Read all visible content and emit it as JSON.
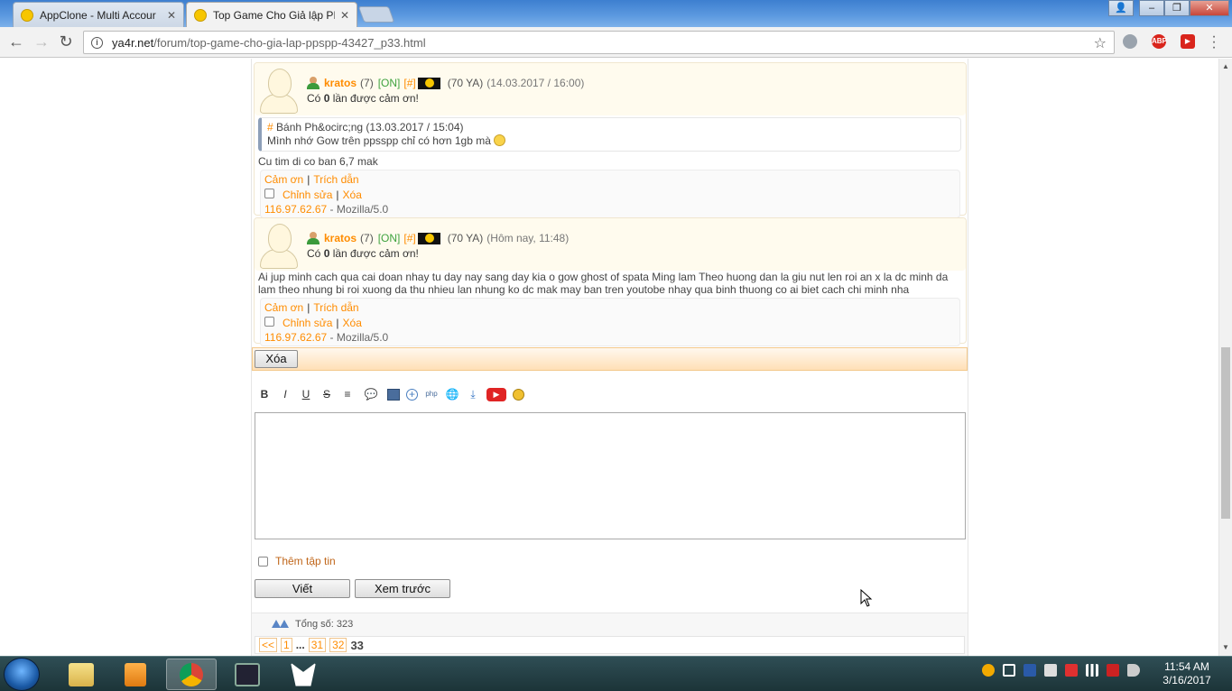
{
  "browser": {
    "tabs": [
      {
        "title": "AppClone - Multi Accour",
        "active": false
      },
      {
        "title": "Top Game Cho Giả lập PI",
        "active": true
      }
    ],
    "url_host": "ya4r.net",
    "url_path": "/forum/top-game-cho-gia-lap-ppspp-43427_p33.html",
    "extensions": [
      "ABP"
    ]
  },
  "posts": [
    {
      "username": "kratos",
      "count": "(7)",
      "status": "[ON]",
      "hash": "[#]",
      "ya": "(70 YA)",
      "time": "(14.03.2017 / 16:00)",
      "thanks_prefix": "Có ",
      "thanks_count": "0",
      "thanks_suffix": " lần được cảm ơn!",
      "quote": {
        "hash": "#",
        "author_line": " Bánh Ph&ocirc;ng (13.03.2017 / 15:04)",
        "text": "Mình nhớ Gow trên ppsspp chỉ có hơn 1gb mà "
      },
      "message": "Cu tim di co ban 6,7 mak",
      "thank_link": "Cảm ơn",
      "quote_link": "Trích dẫn",
      "edit_link": "Chỉnh sửa",
      "delete_link": "Xóa",
      "ip": "116.97.62.67",
      "agent": " - Mozilla/5.0"
    },
    {
      "username": "kratos",
      "count": "(7)",
      "status": "[ON]",
      "hash": "[#]",
      "ya": "(70 YA)",
      "time": "(Hôm nay, 11:48)",
      "thanks_prefix": "Có ",
      "thanks_count": "0",
      "thanks_suffix": " lần được cảm ơn!",
      "message": "Ai jup minh cach qua cai doan nhay tu day nay sang day kia o gow ghost of spata Ming lam Theo huong dan la giu nut len roi an x la dc minh da lam theo nhung bi roi xuong da thu nhieu lan nhung ko dc mak may ban tren youtobe nhay qua binh thuong co ai biet cach chi minh nha",
      "thank_link": "Cảm ơn",
      "quote_link": "Trích dẫn",
      "edit_link": "Chỉnh sửa",
      "delete_link": "Xóa",
      "ip": "116.97.62.67",
      "agent": " - Mozilla/5.0"
    }
  ],
  "delete_button": "Xóa",
  "editor": {
    "tools": [
      "B",
      "I",
      "U",
      "S"
    ],
    "textarea_value": "",
    "attach_label": "Thêm tập tin",
    "submit_label": "Viết",
    "preview_label": "Xem trước"
  },
  "footer": {
    "total": "Tổng số: 323",
    "pages": [
      "<<",
      "1",
      "31",
      "32"
    ],
    "dots": "...",
    "current": "33"
  },
  "taskbar": {
    "time": "11:54 AM",
    "date": "3/16/2017"
  },
  "colors": {
    "accent": "#ff8c00",
    "online": "#3fa33f"
  }
}
